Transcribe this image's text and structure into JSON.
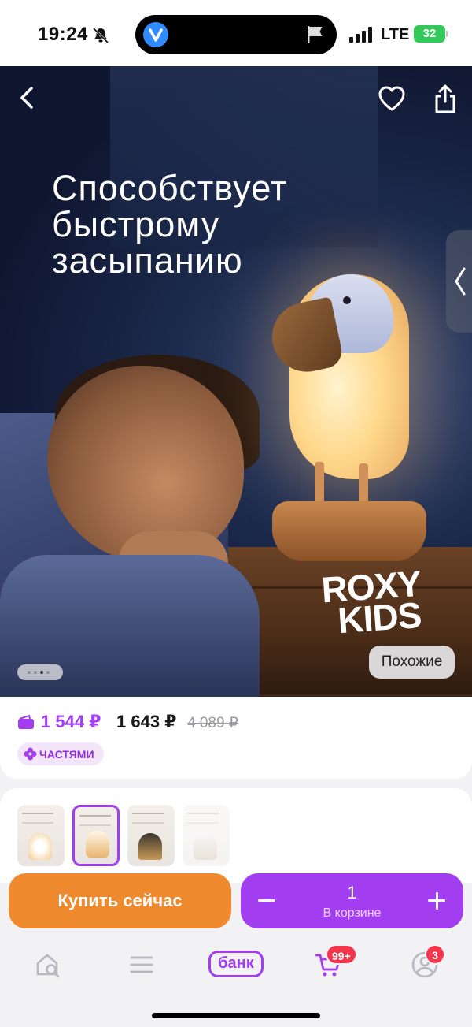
{
  "status_bar": {
    "time": "19:24",
    "network": "LTE",
    "battery": "32",
    "icons": [
      "bell-slash-icon",
      "app-icon",
      "flag-icon",
      "signal-icon",
      "battery-icon"
    ]
  },
  "hero": {
    "caption_lines": [
      "Способствует",
      "быстрому",
      "засыпанию"
    ],
    "brand_lines": [
      "ROXY",
      "KIDS"
    ],
    "similar_label": "Похожие",
    "pager_dots": 4,
    "active_dot": 2,
    "icons": [
      "back-icon",
      "heart-icon",
      "share-icon",
      "chevron-left-icon"
    ]
  },
  "price": {
    "card_price": "1 544 ₽",
    "regular_price": "1 643 ₽",
    "old_price": "4 089 ₽",
    "installments_label": "ЧАСТЯМИ"
  },
  "variants": {
    "count": 4,
    "selected_index": 1
  },
  "actions": {
    "buy_now_label": "Купить сейчас",
    "quantity": "1",
    "in_cart_label": "В корзине"
  },
  "tab_bar": {
    "bank_label": "банк",
    "cart_badge": "99+",
    "profile_badge": "3"
  },
  "colors": {
    "accent": "#a23df0",
    "buy": "#f08a2e",
    "badge": "#f4364c"
  }
}
